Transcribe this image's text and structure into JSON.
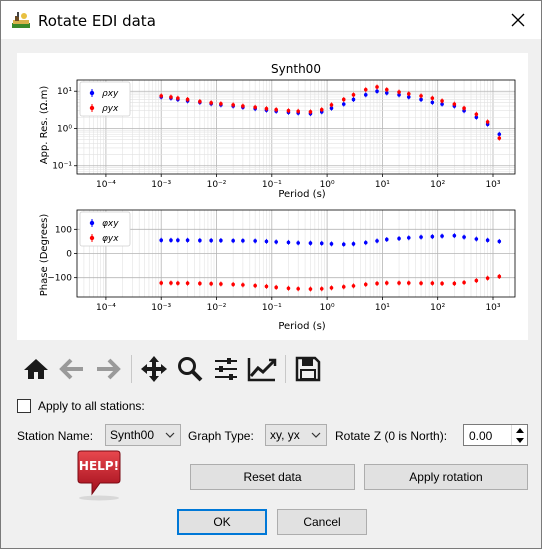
{
  "window": {
    "title": "Rotate EDI data",
    "close_glyph": "✕"
  },
  "plot": {
    "title": "Synth00",
    "top_ylabel": "App. Res. (Ω.m)",
    "bottom_ylabel": "Phase (Degrees)",
    "xlabel": "Period (s)",
    "top_yticks": [
      "10¹",
      "10⁰",
      "10⁻¹"
    ],
    "bottom_yticks": [
      "100",
      "0",
      "−100"
    ],
    "xticks": [
      "10⁻⁴",
      "10⁻³",
      "10⁻²",
      "10⁻¹",
      "10⁰",
      "10¹",
      "10²",
      "10³"
    ],
    "legend_top": [
      "ρxy",
      "ρyx"
    ],
    "legend_bottom": [
      "φxy",
      "φyx"
    ]
  },
  "chart_data": [
    {
      "type": "scatter",
      "title": "Synth00",
      "xlabel": "Period (s)",
      "ylabel": "App. Res. (Ω.m)",
      "xscale": "log",
      "yscale": "log",
      "xlim": [
        3e-05,
        2500
      ],
      "ylim": [
        0.06,
        20
      ],
      "grid": true,
      "legend": "top-left",
      "series": [
        {
          "name": "ρxy",
          "color": "#0000ff",
          "x": [
            0.001,
            0.0015,
            0.002,
            0.003,
            0.005,
            0.008,
            0.012,
            0.02,
            0.03,
            0.05,
            0.08,
            0.12,
            0.2,
            0.3,
            0.5,
            0.8,
            1.2,
            2,
            3,
            5,
            8,
            12,
            20,
            30,
            50,
            80,
            120,
            200,
            300,
            500,
            800,
            1300
          ],
          "y": [
            7,
            6.5,
            6,
            5.5,
            5,
            4.6,
            4.3,
            4,
            3.7,
            3.4,
            3.1,
            2.9,
            2.7,
            2.6,
            2.5,
            2.8,
            3.5,
            4.5,
            6,
            8,
            10,
            9,
            8,
            7,
            6,
            5,
            4.5,
            4,
            3,
            2,
            1.3,
            0.7
          ]
        },
        {
          "name": "ρyx",
          "color": "#ff0000",
          "x": [
            0.001,
            0.0015,
            0.002,
            0.003,
            0.005,
            0.008,
            0.012,
            0.02,
            0.03,
            0.05,
            0.08,
            0.12,
            0.2,
            0.3,
            0.5,
            0.8,
            1.2,
            2,
            3,
            5,
            8,
            12,
            20,
            30,
            50,
            80,
            120,
            200,
            300,
            500,
            800,
            1300
          ],
          "y": [
            7.5,
            7,
            6.5,
            6,
            5.3,
            4.9,
            4.6,
            4.3,
            4,
            3.7,
            3.4,
            3.2,
            3,
            2.9,
            2.8,
            3.2,
            4.3,
            6,
            8,
            11,
            13,
            11,
            9.5,
            8.5,
            7.5,
            6.5,
            5.5,
            4.5,
            3.5,
            2.4,
            1.5,
            0.55
          ]
        }
      ]
    },
    {
      "type": "scatter",
      "xlabel": "Period (s)",
      "ylabel": "Phase (Degrees)",
      "xscale": "log",
      "xlim": [
        3e-05,
        2500
      ],
      "ylim": [
        -180,
        180
      ],
      "grid": true,
      "legend": "top-left",
      "series": [
        {
          "name": "φxy",
          "color": "#0000ff",
          "x": [
            0.001,
            0.0015,
            0.002,
            0.003,
            0.005,
            0.008,
            0.012,
            0.02,
            0.03,
            0.05,
            0.08,
            0.12,
            0.2,
            0.3,
            0.5,
            0.8,
            1.2,
            2,
            3,
            5,
            8,
            12,
            20,
            30,
            50,
            80,
            120,
            200,
            300,
            500,
            800,
            1300
          ],
          "y": [
            55,
            55,
            55,
            55,
            54,
            54,
            54,
            53,
            53,
            52,
            50,
            48,
            46,
            44,
            43,
            42,
            40,
            38,
            40,
            45,
            52,
            58,
            62,
            65,
            68,
            70,
            72,
            74,
            68,
            60,
            55,
            50
          ]
        },
        {
          "name": "φyx",
          "color": "#ff0000",
          "x": [
            0.001,
            0.0015,
            0.002,
            0.003,
            0.005,
            0.008,
            0.012,
            0.02,
            0.03,
            0.05,
            0.08,
            0.12,
            0.2,
            0.3,
            0.5,
            0.8,
            1.2,
            2,
            3,
            5,
            8,
            12,
            20,
            30,
            50,
            80,
            120,
            200,
            300,
            500,
            800,
            1300
          ],
          "y": [
            -122,
            -122,
            -123,
            -123,
            -124,
            -125,
            -126,
            -128,
            -130,
            -133,
            -136,
            -140,
            -144,
            -146,
            -147,
            -146,
            -142,
            -138,
            -134,
            -128,
            -124,
            -122,
            -122,
            -122,
            -123,
            -123,
            -124,
            -124,
            -120,
            -112,
            -102,
            -95
          ]
        }
      ]
    }
  ],
  "toolbar": {
    "icons": [
      "home-icon",
      "back-arrow-icon",
      "forward-arrow-icon",
      "pan-icon",
      "zoom-icon",
      "subplots-icon",
      "line-edit-icon",
      "save-icon"
    ]
  },
  "controls": {
    "apply_all_label": "Apply to all stations:",
    "station_label": "Station Name:",
    "station_value": "Synth00",
    "graph_type_label": "Graph Type:",
    "graph_type_value": "xy, yx",
    "rotate_label": "Rotate Z (0 is North):",
    "rotate_value": "0.00",
    "help_label": "HELP!",
    "reset_label": "Reset data",
    "apply_label": "Apply rotation",
    "ok_label": "OK",
    "cancel_label": "Cancel"
  },
  "colors": {
    "accent": "#0078d7",
    "xy": "#0000ff",
    "yx": "#ff0000",
    "help_red": "#c8102e"
  }
}
